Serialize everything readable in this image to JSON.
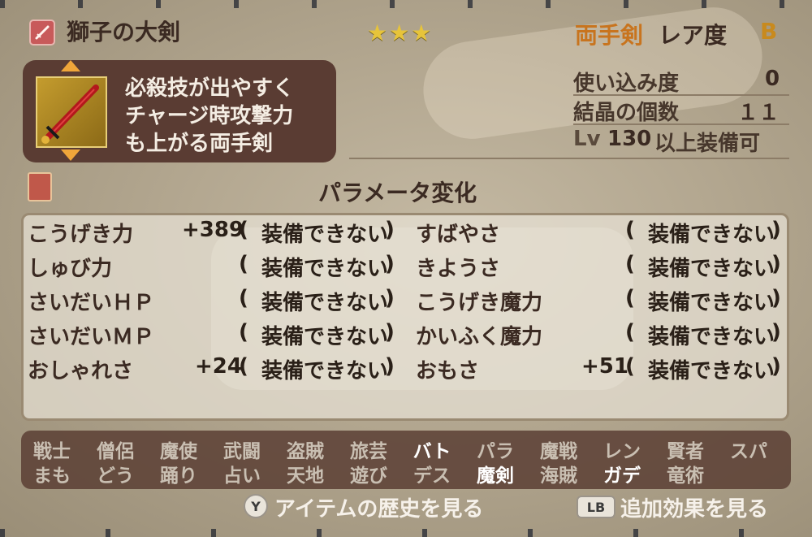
{
  "header": {
    "item_name": "獅子の大剣",
    "stars": "★★★",
    "weapon_type": "両手剣",
    "rarity_label": "レア度",
    "rarity_value": "B"
  },
  "description": {
    "lines": [
      "必殺技が出やすく",
      "チャージ時攻撃力",
      "も上がる両手剣"
    ]
  },
  "stats": {
    "usage": {
      "label": "使い込み度",
      "value": "0"
    },
    "crystals": {
      "label": "結晶の個数",
      "value": "１１"
    },
    "level": {
      "prefix": "Lv",
      "value": "130",
      "suffix": "以上装備可"
    }
  },
  "params": {
    "title": "パラメータ変化",
    "left": [
      {
        "label": "こうげき力",
        "value": "+389",
        "status": "装備できない"
      },
      {
        "label": "しゅび力",
        "value": "",
        "status": "装備できない"
      },
      {
        "label": "さいだいＨＰ",
        "value": "",
        "status": "装備できない"
      },
      {
        "label": "さいだいＭＰ",
        "value": "",
        "status": "装備できない"
      },
      {
        "label": "おしゃれさ",
        "value": "+24",
        "status": "装備できない"
      }
    ],
    "right": [
      {
        "label": "すばやさ",
        "value": "",
        "status": "装備できない"
      },
      {
        "label": "きようさ",
        "value": "",
        "status": "装備できない"
      },
      {
        "label": "こうげき魔力",
        "value": "",
        "status": "装備できない"
      },
      {
        "label": "かいふく魔力",
        "value": "",
        "status": "装備できない"
      },
      {
        "label": "おもさ",
        "value": "+51",
        "status": "装備できない"
      }
    ]
  },
  "jobs": {
    "row1": [
      "戦士",
      "僧侶",
      "魔使",
      "武闘",
      "盗賊",
      "旅芸",
      "バト",
      "パラ",
      "魔戦",
      "レン",
      "賢者",
      "スパ"
    ],
    "row2": [
      "まも",
      "どう",
      "踊り",
      "占い",
      "天地",
      "遊び",
      "デス",
      "魔剣",
      "海賊",
      "ガデ",
      "竜術"
    ]
  },
  "footer": {
    "y_key": "Y",
    "y_action": "アイテムの歴史を見る",
    "lb_key": "LB",
    "lb_action": "追加効果を見る"
  },
  "colors": {
    "weapon_type": "#c8741e",
    "rarity": "#c88a1e",
    "star": "#e7c43a",
    "desc_box": "#5a3c33",
    "job_active": "#ffffff",
    "job_inactive": "#c9bfb2"
  }
}
